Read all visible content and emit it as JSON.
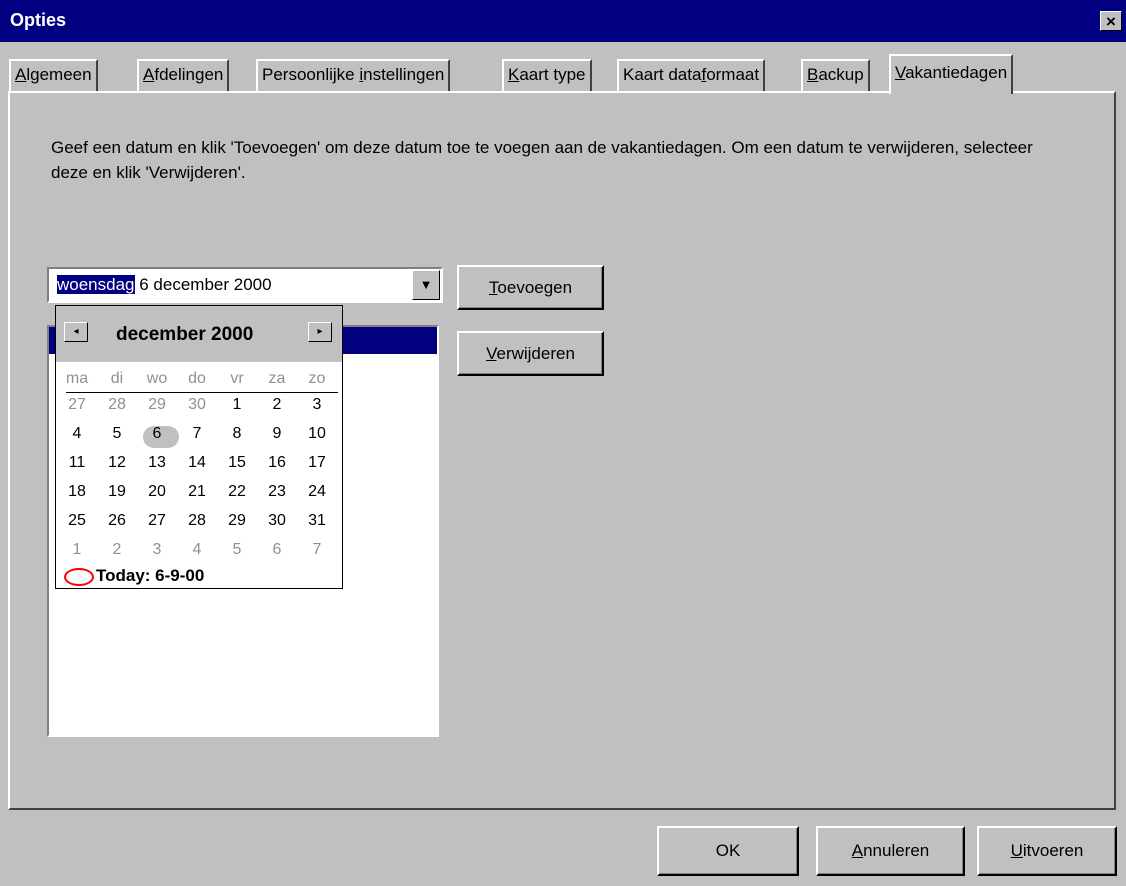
{
  "window": {
    "title": "Opties",
    "close_label": "×"
  },
  "tabs": [
    {
      "pre": "",
      "u": "A",
      "post": "lgemeen"
    },
    {
      "pre": "",
      "u": "A",
      "post": "fdelingen"
    },
    {
      "pre": "Persoonlijke ",
      "u": "i",
      "post": "nstellingen"
    },
    {
      "pre": "",
      "u": "K",
      "post": "aart type"
    },
    {
      "pre": "Kaart data",
      "u": "f",
      "post": "ormaat"
    },
    {
      "pre": "",
      "u": "B",
      "post": "ackup"
    },
    {
      "pre": "",
      "u": "V",
      "post": "akantiedagen"
    }
  ],
  "active_tab": "Vakantiedagen",
  "description": "Geef een datum en klik 'Toevoegen' om deze datum toe te voegen aan de vakantiedagen. Om een datum te verwijderen, selecteer deze en klik 'Verwijderen'.",
  "date_picker": {
    "selected_word": "woensdag",
    "rest": " 6  december 2000",
    "arrow": "▼"
  },
  "buttons": {
    "add": {
      "u": "T",
      "post": "oevoegen"
    },
    "remove": {
      "u": "V",
      "post": "erwijderen"
    },
    "ok": "OK",
    "cancel": {
      "u": "A",
      "post": "nnuleren"
    },
    "apply": {
      "u": "U",
      "post": "itvoeren"
    }
  },
  "calendar": {
    "prev": "◂",
    "next": "▸",
    "month_title": "december 2000",
    "weekdays": [
      "ma",
      "di",
      "wo",
      "do",
      "vr",
      "za",
      "zo"
    ],
    "weeks": [
      [
        "27",
        "28",
        "29",
        "30",
        "1",
        "2",
        "3"
      ],
      [
        "4",
        "5",
        "6",
        "7",
        "8",
        "9",
        "10"
      ],
      [
        "11",
        "12",
        "13",
        "14",
        "15",
        "16",
        "17"
      ],
      [
        "18",
        "19",
        "20",
        "21",
        "22",
        "23",
        "24"
      ],
      [
        "25",
        "26",
        "27",
        "28",
        "29",
        "30",
        "31"
      ],
      [
        "1",
        "2",
        "3",
        "4",
        "5",
        "6",
        "7"
      ]
    ],
    "selected_day": "6",
    "today_label": "Today: 6-9-00"
  }
}
